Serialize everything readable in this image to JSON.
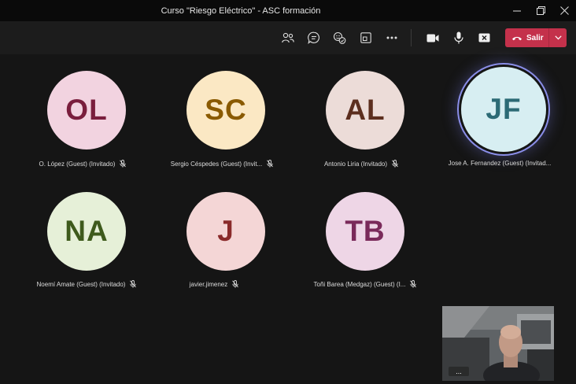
{
  "window": {
    "title": "Curso \"Riesgo Eléctrico\" - ASC formación",
    "controls": [
      "minimize-icon",
      "restore-icon",
      "close-icon"
    ]
  },
  "toolbar": {
    "icons": [
      "people-icon",
      "chat-icon",
      "reactions-icon",
      "share-screen-icon",
      "more-icon",
      "camera-icon",
      "microphone-icon",
      "share-tray-icon"
    ],
    "leave_label": "Salir",
    "leave_color": "#c4314b"
  },
  "participants": [
    {
      "initials": "OL",
      "name": "O. López (Guest) (Invitado)",
      "bg": "#f2d3e0",
      "fg": "#7a1e3d",
      "muted": true,
      "speaking": false
    },
    {
      "initials": "SC",
      "name": "Sergio Céspedes (Guest) (Invit...",
      "bg": "#fbe8c4",
      "fg": "#8a5a00",
      "muted": true,
      "speaking": false
    },
    {
      "initials": "AL",
      "name": "Antonio Liria (Invitado)",
      "bg": "#ecdcd8",
      "fg": "#5c2e1e",
      "muted": true,
      "speaking": false
    },
    {
      "initials": "JF",
      "name": "Jose A. Fernandez (Guest) (Invitad...",
      "bg": "#d7eef2",
      "fg": "#2c6a75",
      "muted": false,
      "speaking": true
    },
    {
      "initials": "NA",
      "name": "Noemí Amate (Guest) (Invitado)",
      "bg": "#e6f0d8",
      "fg": "#3e5a1c",
      "muted": true,
      "speaking": false
    },
    {
      "initials": "J",
      "name": "javier.jimenez",
      "bg": "#f4d6d6",
      "fg": "#8a2b2b",
      "muted": true,
      "speaking": false
    },
    {
      "initials": "TB",
      "name": "Toñi Barea (Medgaz) (Guest) (I...",
      "bg": "#eed6e6",
      "fg": "#7a2a5a",
      "muted": true,
      "speaking": false
    }
  ],
  "self_view": {
    "more_label": "..."
  }
}
